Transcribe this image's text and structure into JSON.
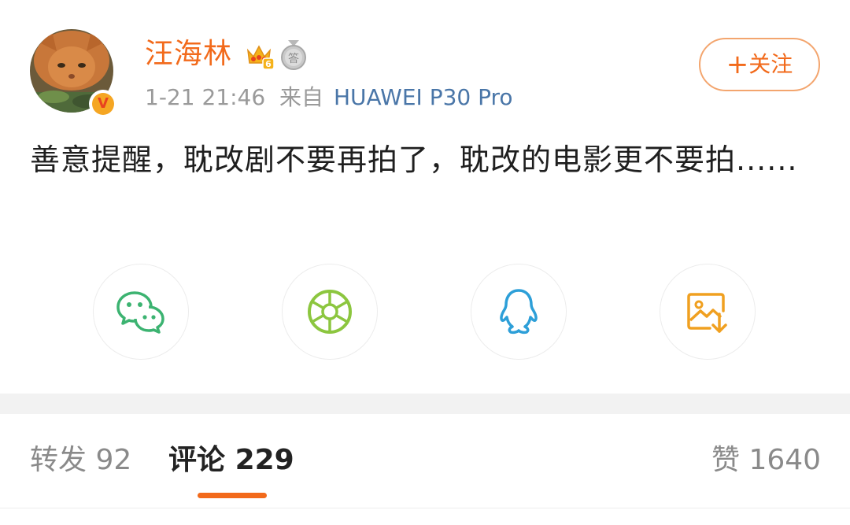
{
  "post": {
    "username": "汪海林",
    "timestamp": "1-21 21:46",
    "source_prefix": "来自",
    "source_device": "HUAWEI P30 Pro",
    "follow_label": "关注",
    "follow_plus": "+",
    "text": "善意提醒，耽改剧不要再拍了，耽改的电影更不要拍......",
    "verified_glyph": "V",
    "member_level": "6",
    "medal_glyph": "答"
  },
  "share": [
    {
      "name": "wechat",
      "icon": "wechat-icon",
      "color": "#3cb371"
    },
    {
      "name": "moments",
      "icon": "moments-aperture-icon",
      "color": "#8cc63f"
    },
    {
      "name": "qq",
      "icon": "qq-penguin-icon",
      "color": "#2d9fd8"
    },
    {
      "name": "save-image",
      "icon": "save-image-icon",
      "color": "#f0a020"
    }
  ],
  "tabs": {
    "repost_label": "转发",
    "repost_count": "92",
    "comment_label": "评论",
    "comment_count": "229",
    "like_label": "赞",
    "like_count": "1640"
  },
  "colors": {
    "accent": "#f26a1b",
    "link": "#4a76a8",
    "muted": "#9a9a9a"
  }
}
